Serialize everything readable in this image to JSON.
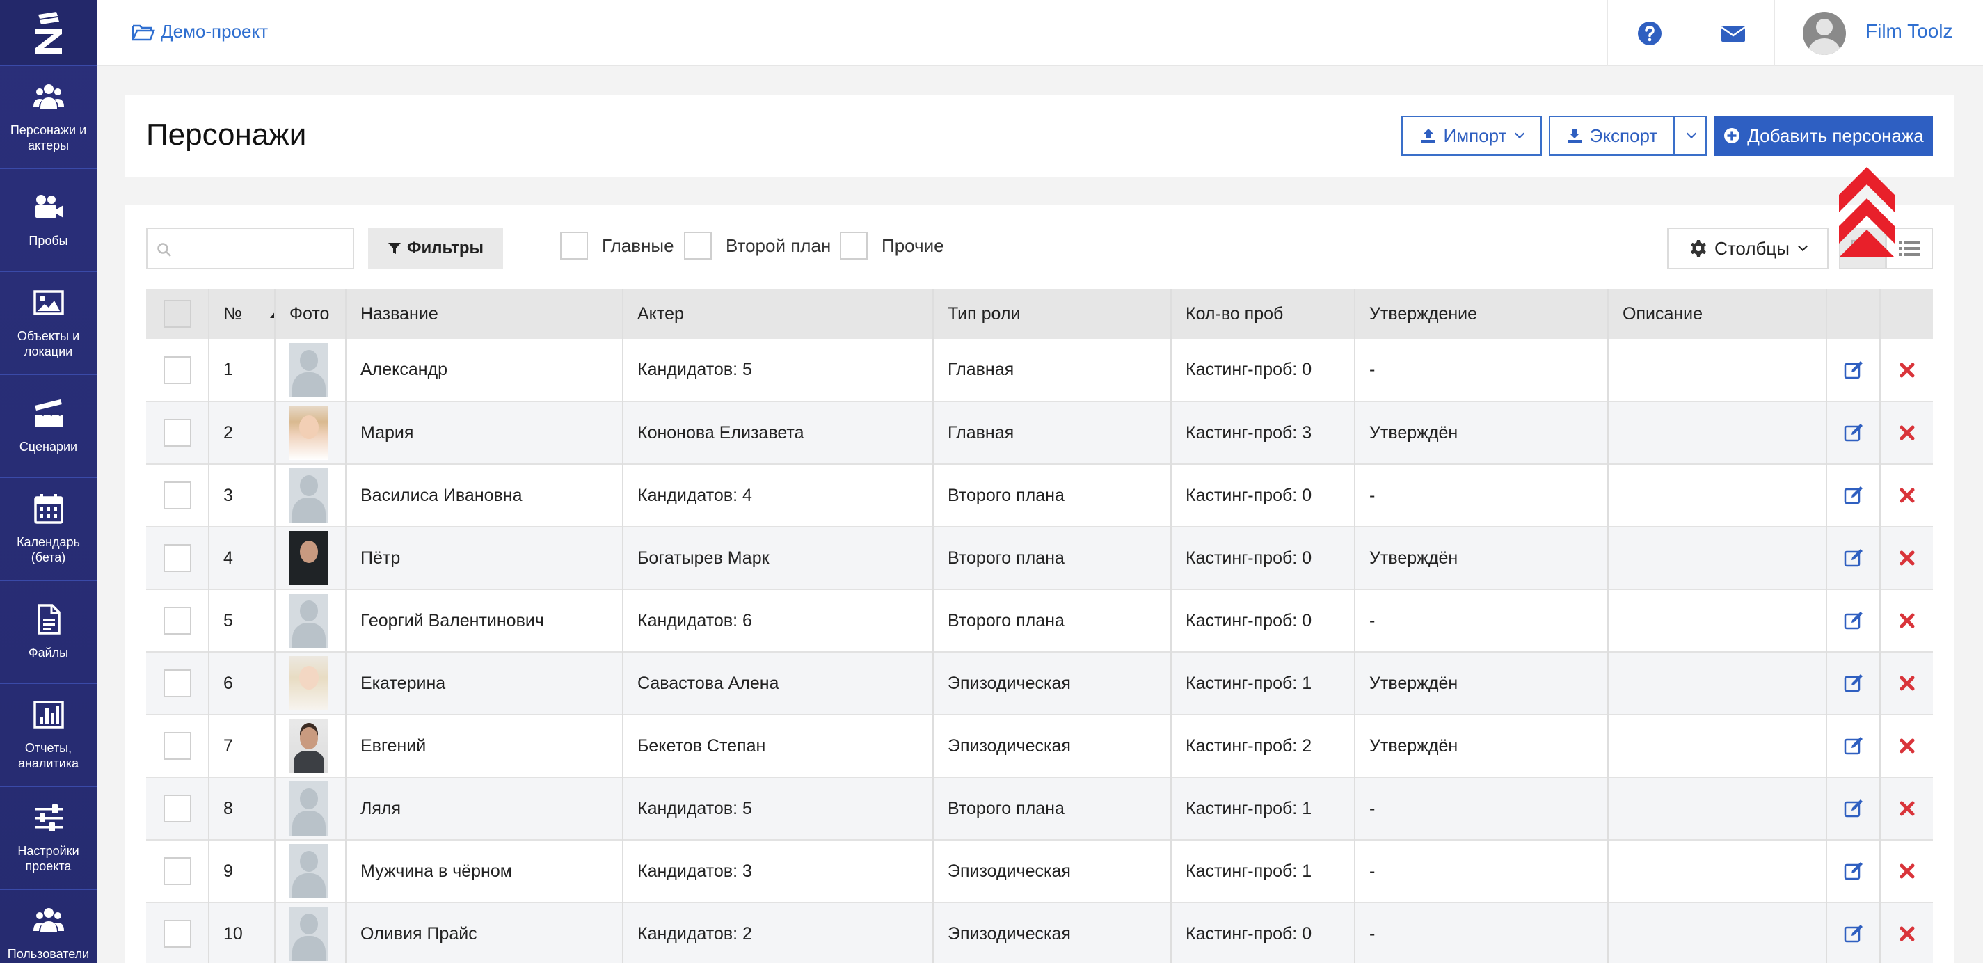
{
  "sidebar": {
    "logo_icon": "filmtoolz-logo-icon",
    "items": [
      {
        "label": "Персонажи и актеры",
        "icon": "users-icon"
      },
      {
        "label": "Пробы",
        "icon": "video-camera-icon"
      },
      {
        "label": "Объекты и локации",
        "icon": "image-icon"
      },
      {
        "label": "Сценарии",
        "icon": "clapperboard-icon"
      },
      {
        "label": "Календарь (бета)",
        "icon": "calendar-icon"
      },
      {
        "label": "Файлы",
        "icon": "file-icon"
      },
      {
        "label": "Отчеты, аналитика",
        "icon": "bar-chart-icon"
      },
      {
        "label": "Настройки проекта",
        "icon": "sliders-icon"
      },
      {
        "label": "Пользователи и",
        "icon": "users-icon"
      }
    ]
  },
  "topbar": {
    "project": "Демо-проект",
    "user_name": "Film Toolz"
  },
  "header": {
    "title": "Персонажи",
    "import_label": "Импорт",
    "export_label": "Экспорт",
    "add_label": "Добавить персонажа"
  },
  "toolbar": {
    "search_placeholder": "",
    "filters_label": "Фильтры",
    "filter_main": "Главные",
    "filter_secondary": "Второй план",
    "filter_other": "Прочие",
    "columns_label": "Столбцы"
  },
  "table": {
    "headers": {
      "num": "№",
      "photo": "Фото",
      "name": "Название",
      "actor": "Актер",
      "role_type": "Тип роли",
      "tests": "Кол-во проб",
      "approval": "Утверждение",
      "description": "Описание"
    },
    "rows": [
      {
        "num": "1",
        "photo": "placeholder",
        "name": "Александр",
        "actor": "Кандидатов: 5",
        "role_type": "Главная",
        "tests": "Кастинг-проб: 0",
        "approval": "-",
        "description": ""
      },
      {
        "num": "2",
        "photo": "f1",
        "name": "Мария",
        "actor": "Кононова Елизавета",
        "role_type": "Главная",
        "tests": "Кастинг-проб: 3",
        "approval": "Утверждён",
        "description": ""
      },
      {
        "num": "3",
        "photo": "placeholder",
        "name": "Василиса Ивановна",
        "actor": "Кандидатов: 4",
        "role_type": "Второго плана",
        "tests": "Кастинг-проб: 0",
        "approval": "-",
        "description": ""
      },
      {
        "num": "4",
        "photo": "m1",
        "name": "Пётр",
        "actor": "Богатырев Марк",
        "role_type": "Второго плана",
        "tests": "Кастинг-проб: 0",
        "approval": "Утверждён",
        "description": ""
      },
      {
        "num": "5",
        "photo": "placeholder",
        "name": "Георгий Валентинович",
        "actor": "Кандидатов: 6",
        "role_type": "Второго плана",
        "tests": "Кастинг-проб: 0",
        "approval": "-",
        "description": ""
      },
      {
        "num": "6",
        "photo": "f2",
        "name": "Екатерина",
        "actor": "Савастова Алена",
        "role_type": "Эпизодическая",
        "tests": "Кастинг-проб: 1",
        "approval": "Утверждён",
        "description": ""
      },
      {
        "num": "7",
        "photo": "m2",
        "name": "Евгений",
        "actor": "Бекетов Степан",
        "role_type": "Эпизодическая",
        "tests": "Кастинг-проб: 2",
        "approval": "Утверждён",
        "description": ""
      },
      {
        "num": "8",
        "photo": "placeholder",
        "name": "Ляля",
        "actor": "Кандидатов: 5",
        "role_type": "Второго плана",
        "tests": "Кастинг-проб: 1",
        "approval": "-",
        "description": ""
      },
      {
        "num": "9",
        "photo": "placeholder",
        "name": "Мужчина в чёрном",
        "actor": "Кандидатов: 3",
        "role_type": "Эпизодическая",
        "tests": "Кастинг-проб: 1",
        "approval": "-",
        "description": ""
      },
      {
        "num": "10",
        "photo": "placeholder",
        "name": "Оливия Прайс",
        "actor": "Кандидатов: 2",
        "role_type": "Эпизодическая",
        "tests": "Кастинг-проб: 0",
        "approval": "-",
        "description": ""
      }
    ]
  },
  "colors": {
    "sidebar_bg": "#262b70",
    "accent_blue": "#2e5fc2",
    "delete_red": "#d9343a",
    "highlight_arrow": "#e8202a"
  }
}
